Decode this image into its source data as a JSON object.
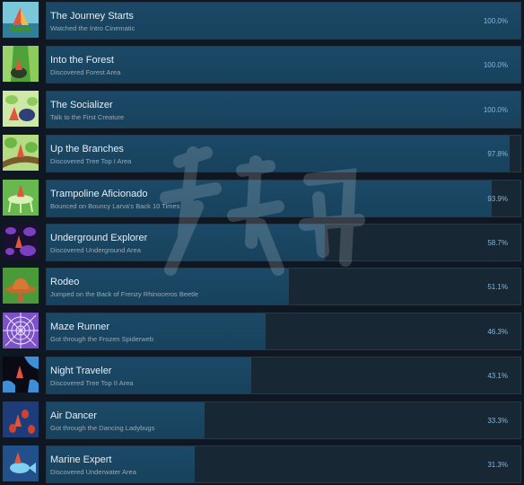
{
  "achievements": [
    {
      "title": "The Journey Starts",
      "description": "Watched the Intro Cinematic",
      "percent": "100.0%",
      "fill": 1.0,
      "icon": "sailboat-icon"
    },
    {
      "title": "Into the Forest",
      "description": "Discovered Forest Area",
      "percent": "100.0%",
      "fill": 1.0,
      "icon": "forest-icon"
    },
    {
      "title": "The Socializer",
      "description": "Talk to the First Creature",
      "percent": "100.0%",
      "fill": 1.0,
      "icon": "creature-icon"
    },
    {
      "title": "Up the Branches",
      "description": "Discovered Tree Top I Area",
      "percent": "97.8%",
      "fill": 0.978,
      "icon": "branches-icon"
    },
    {
      "title": "Trampoline Aficionado",
      "description": "Bounced on Bouncy Larva's Back 10 Times",
      "percent": "93.9%",
      "fill": 0.939,
      "icon": "trampoline-icon"
    },
    {
      "title": "Underground Explorer",
      "description": "Discovered Underground Area",
      "percent": "58.7%",
      "fill": 0.587,
      "icon": "underground-icon"
    },
    {
      "title": "Rodeo",
      "description": "Jumped on the Back of Frenzy Rhinoceros Beetle",
      "percent": "51.1%",
      "fill": 0.511,
      "icon": "cowboy-hat-icon"
    },
    {
      "title": "Maze Runner",
      "description": "Got through the Frozen Spiderweb",
      "percent": "46.3%",
      "fill": 0.463,
      "icon": "spiderweb-icon"
    },
    {
      "title": "Night Traveler",
      "description": "Discovered Tree Top II Area",
      "percent": "43.1%",
      "fill": 0.431,
      "icon": "night-icon"
    },
    {
      "title": "Air Dancer",
      "description": "Got through the Dancing Ladybugs",
      "percent": "33.3%",
      "fill": 0.333,
      "icon": "ladybugs-icon"
    },
    {
      "title": "Marine Expert",
      "description": "Discovered Underwater Area",
      "percent": "31.3%",
      "fill": 0.313,
      "icon": "fish-icon"
    }
  ]
}
